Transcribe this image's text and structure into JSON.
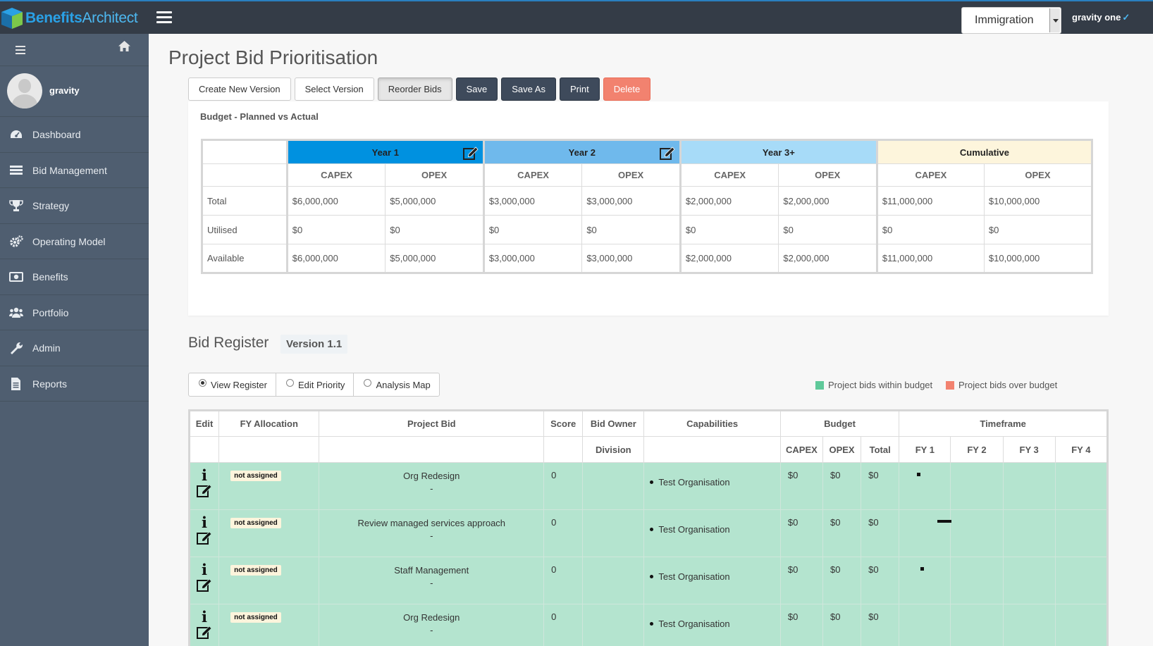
{
  "app": {
    "brand_part1": "Benefits",
    "brand_part2": "Architect",
    "tenant": "Immigration",
    "user_menu": "gravity one"
  },
  "sidebar": {
    "username": "gravity",
    "items": [
      {
        "label": "Dashboard",
        "icon": "dashboard-icon"
      },
      {
        "label": "Bid Management",
        "icon": "list-icon"
      },
      {
        "label": "Strategy",
        "icon": "trophy-icon"
      },
      {
        "label": "Operating Model",
        "icon": "cogs-icon"
      },
      {
        "label": "Benefits",
        "icon": "money-icon"
      },
      {
        "label": "Portfolio",
        "icon": "users-icon"
      },
      {
        "label": "Admin",
        "icon": "wrench-icon"
      },
      {
        "label": "Reports",
        "icon": "file-icon"
      }
    ]
  },
  "page": {
    "title": "Project Bid Prioritisation",
    "buttons": {
      "create": "Create New Version",
      "select": "Select Version",
      "reorder": "Reorder Bids",
      "save": "Save",
      "save_as": "Save As",
      "print": "Print",
      "delete": "Delete"
    }
  },
  "budget": {
    "panel_title": "Budget - Planned vs Actual",
    "years": [
      "Year 1",
      "Year 2",
      "Year 3+",
      "Cumulative"
    ],
    "capex_label": "CAPEX",
    "opex_label": "OPEX",
    "rows": [
      {
        "label": "Total",
        "values": [
          "$6,000,000",
          "$5,000,000",
          "$3,000,000",
          "$3,000,000",
          "$2,000,000",
          "$2,000,000",
          "$11,000,000",
          "$10,000,000"
        ]
      },
      {
        "label": "Utilised",
        "values": [
          "$0",
          "$0",
          "$0",
          "$0",
          "$0",
          "$0",
          "$0",
          "$0"
        ]
      },
      {
        "label": "Available",
        "values": [
          "$6,000,000",
          "$5,000,000",
          "$3,000,000",
          "$3,000,000",
          "$2,000,000",
          "$2,000,000",
          "$11,000,000",
          "$10,000,000"
        ]
      }
    ]
  },
  "register": {
    "title": "Bid Register",
    "version": "Version 1.1",
    "views": [
      "View Register",
      "Edit Priority",
      "Analysis Map"
    ],
    "selected_view": "View Register",
    "legend_within": "Project bids within budget",
    "legend_over": "Project bids over budget",
    "colors": {
      "within": "#5fc99a",
      "over": "#f2826f",
      "row_bg": "#b4e4cf"
    },
    "headers": {
      "edit": "Edit",
      "fy_allocation": "FY Allocation",
      "project_bid": "Project Bid",
      "score": "Score",
      "bid_owner": "Bid Owner",
      "division": "Division",
      "capabilities": "Capabilities",
      "budget": "Budget",
      "capex": "CAPEX",
      "opex": "OPEX",
      "total": "Total",
      "timeframe": "Timeframe",
      "fy": [
        "FY 1",
        "FY 2",
        "FY 3",
        "FY 4"
      ]
    },
    "rows": [
      {
        "allocation": "not assigned",
        "name": "Org Redesign",
        "sub": "-",
        "score": "0",
        "capability": "Test Organisation",
        "capex": "$0",
        "opex": "$0",
        "total": "$0"
      },
      {
        "allocation": "not assigned",
        "name": "Review managed services approach",
        "sub": "-",
        "score": "0",
        "capability": "Test Organisation",
        "capex": "$0",
        "opex": "$0",
        "total": "$0"
      },
      {
        "allocation": "not assigned",
        "name": "Staff Management",
        "sub": "-",
        "score": "0",
        "capability": "Test Organisation",
        "capex": "$0",
        "opex": "$0",
        "total": "$0"
      },
      {
        "allocation": "not assigned",
        "name": "Org Redesign",
        "sub": "-",
        "score": "0",
        "capability": "Test Organisation",
        "capex": "$0",
        "opex": "$0",
        "total": "$0"
      }
    ]
  }
}
